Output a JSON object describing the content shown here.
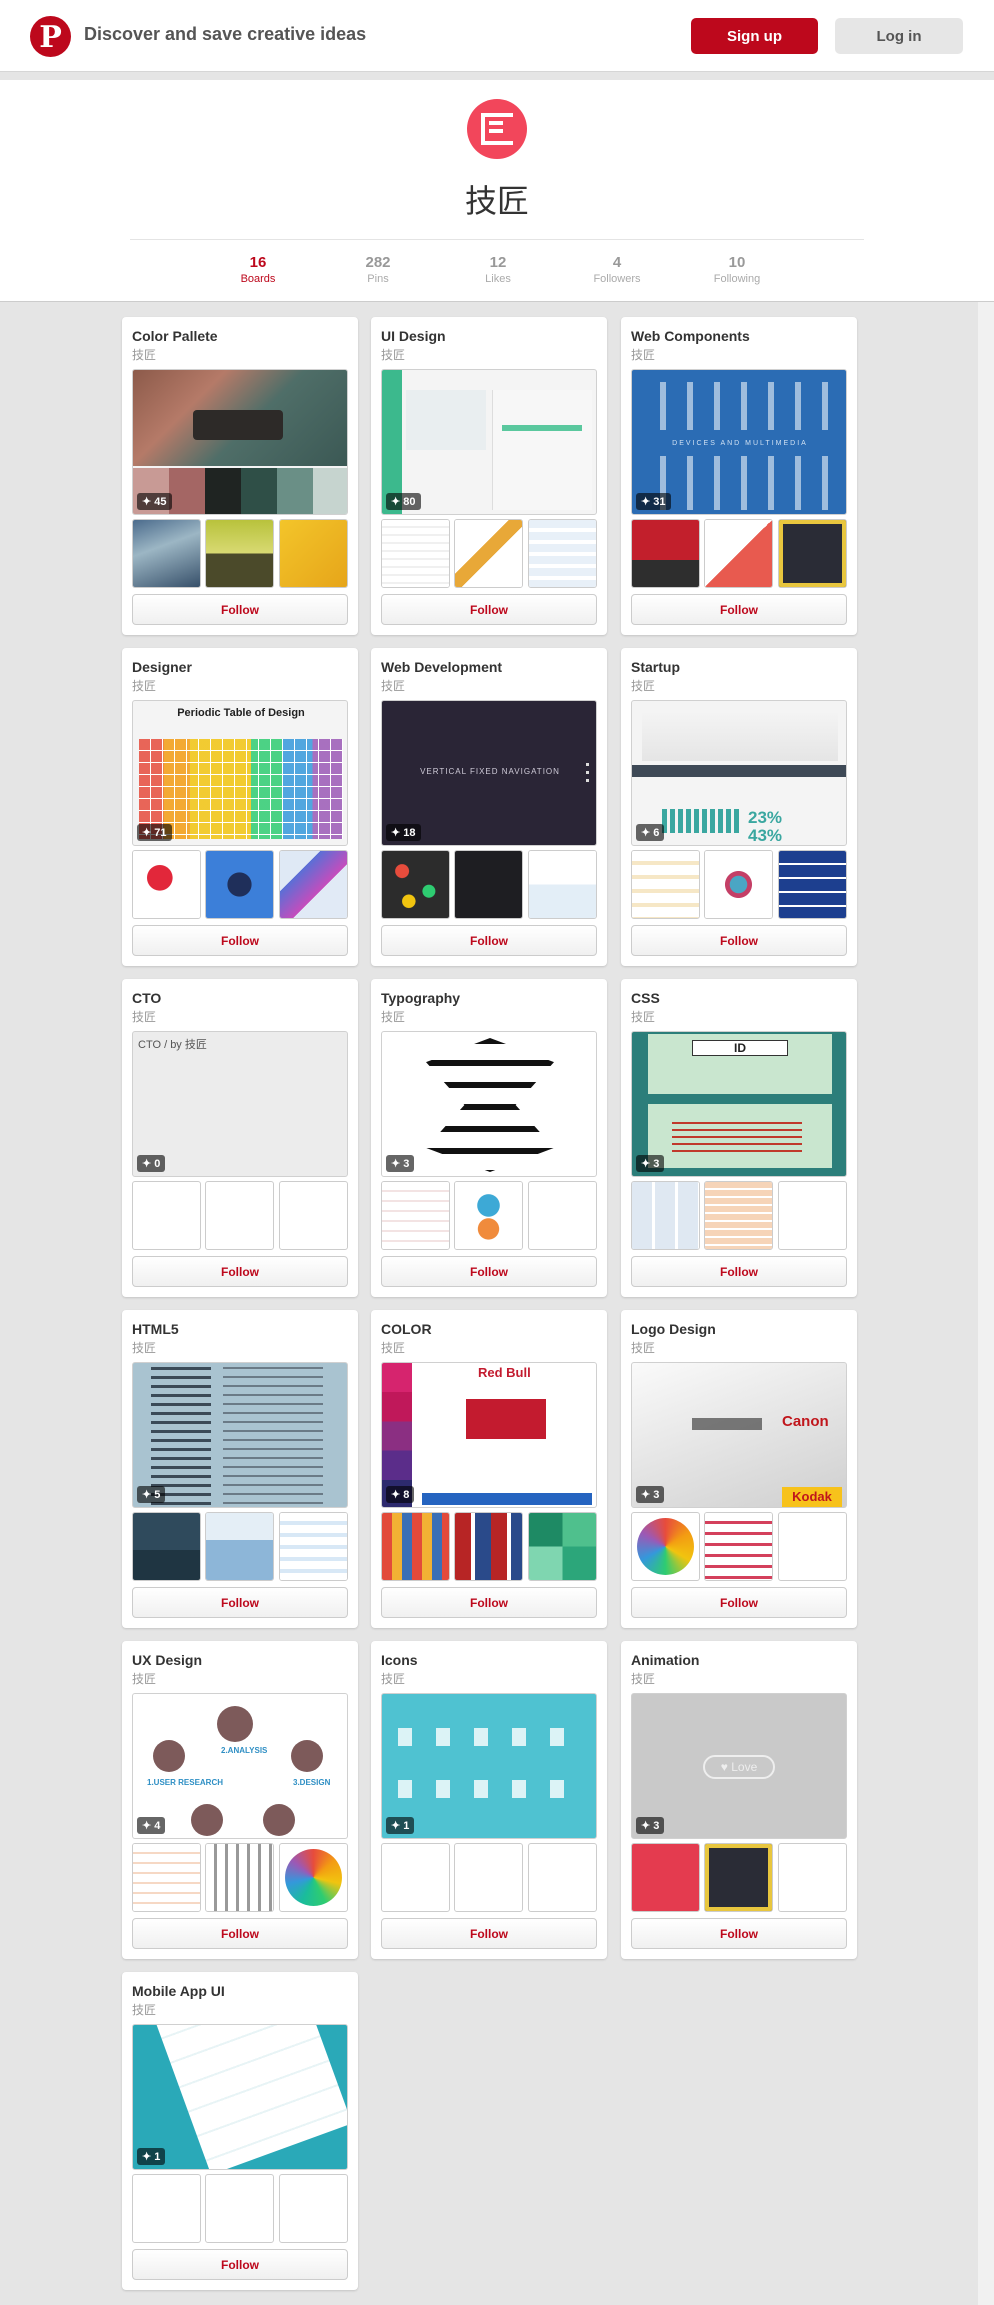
{
  "header": {
    "tagline": "Discover and save creative ideas",
    "signup_label": "Sign up",
    "login_label": "Log in",
    "logo_glyph": "P"
  },
  "profile": {
    "name": "技匠",
    "stats": [
      {
        "num": "16",
        "label": "Boards"
      },
      {
        "num": "282",
        "label": "Pins"
      },
      {
        "num": "12",
        "label": "Likes"
      },
      {
        "num": "4",
        "label": "Followers"
      },
      {
        "num": "10",
        "label": "Following"
      }
    ]
  },
  "boards": [
    {
      "title": "Color Pallete",
      "owner": "技匠",
      "pins": "45",
      "follow": "Follow"
    },
    {
      "title": "UI Design",
      "owner": "技匠",
      "pins": "80",
      "follow": "Follow"
    },
    {
      "title": "Web Components",
      "owner": "技匠",
      "pins": "31",
      "follow": "Follow"
    },
    {
      "title": "Designer",
      "owner": "技匠",
      "pins": "71",
      "follow": "Follow"
    },
    {
      "title": "Web Development",
      "owner": "技匠",
      "pins": "18",
      "follow": "Follow"
    },
    {
      "title": "Startup",
      "owner": "技匠",
      "pins": "6",
      "follow": "Follow"
    },
    {
      "title": "CTO",
      "owner": "技匠",
      "pins": "0",
      "follow": "Follow",
      "cover_text": "CTO / by 技匠"
    },
    {
      "title": "Typography",
      "owner": "技匠",
      "pins": "3",
      "follow": "Follow"
    },
    {
      "title": "CSS",
      "owner": "技匠",
      "pins": "3",
      "follow": "Follow"
    },
    {
      "title": "HTML5",
      "owner": "技匠",
      "pins": "5",
      "follow": "Follow"
    },
    {
      "title": "COLOR",
      "owner": "技匠",
      "pins": "8",
      "follow": "Follow"
    },
    {
      "title": "Logo Design",
      "owner": "技匠",
      "pins": "3",
      "follow": "Follow"
    },
    {
      "title": "UX Design",
      "owner": "技匠",
      "pins": "4",
      "follow": "Follow"
    },
    {
      "title": "Icons",
      "owner": "技匠",
      "pins": "1",
      "follow": "Follow"
    },
    {
      "title": "Animation",
      "owner": "技匠",
      "pins": "3",
      "follow": "Follow"
    },
    {
      "title": "Mobile App UI",
      "owner": "技匠",
      "pins": "1",
      "follow": "Follow"
    }
  ],
  "cover_texts": {
    "designer": "Periodic Table of Design",
    "webdev": "VERTICAL FIXED NAVIGATION",
    "startup_pct1": "23%",
    "startup_pct2": "43%",
    "css_id": "ID",
    "color_brand": "Red Bull",
    "logo_canon": "Canon",
    "logo_kodak": "Kodak",
    "ux_step1": "1.USER RESEARCH",
    "ux_step2": "2.ANALYSIS",
    "ux_step3": "3.DESIGN",
    "animation_love": "Love",
    "webcomp_label": "DEVICES AND MULTIMEDIA"
  },
  "colors": {
    "brand_red": "#bd081c",
    "avatar": "#f2465b",
    "teal": "#3ab0b4",
    "blue": "#2b6cb4"
  }
}
